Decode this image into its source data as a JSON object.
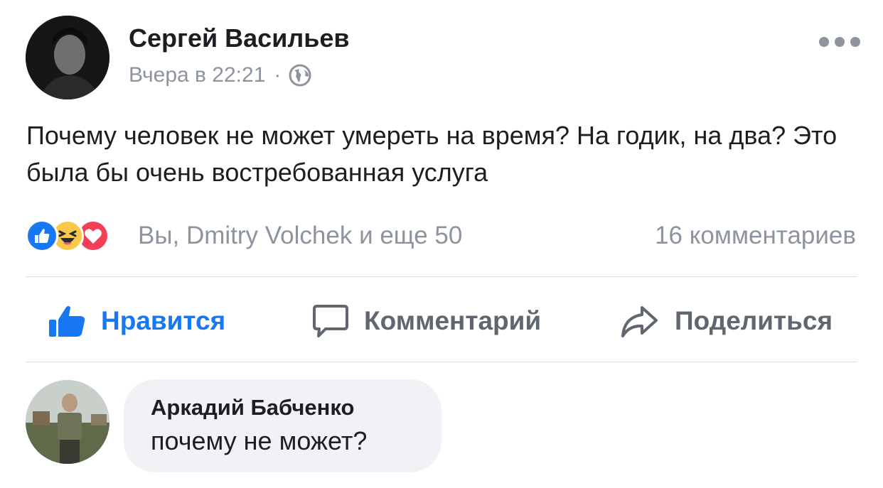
{
  "post": {
    "author": "Сергей Васильев",
    "timestamp": "Вчера в 22:21",
    "separator": "·",
    "privacy_icon": "globe-icon",
    "more_icon": "more-dots-icon",
    "text": "Почему человек не может умереть на время? На годик, на два? Это была бы очень востребованная услуга"
  },
  "reactions": {
    "icons": [
      "like-reaction-icon",
      "haha-reaction-icon",
      "love-reaction-icon"
    ],
    "summary": "Вы, Dmitry Volchek и еще 50",
    "comments_count": "16 комментариев"
  },
  "actions": {
    "like": "Нравится",
    "comment": "Комментарий",
    "share": "Поделиться"
  },
  "comment": {
    "author": "Аркадий Бабченко",
    "text": "почему не может?"
  },
  "colors": {
    "accent": "#1877f2",
    "secondary_text": "#8d949e",
    "action_text": "#606770",
    "bubble_bg": "#f0f2f5",
    "love": "#f33e58",
    "haha": "#f7b125"
  }
}
